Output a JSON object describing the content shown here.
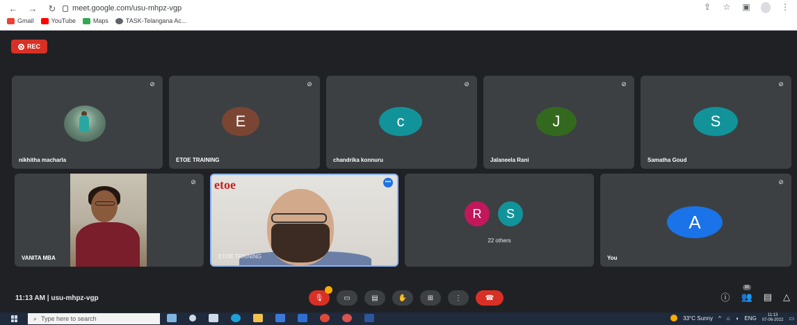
{
  "browser": {
    "url": "meet.google.com/usu-mhpz-vgp",
    "bookmarks": [
      "Gmail",
      "YouTube",
      "Maps",
      "TASK-Telangana Ac..."
    ]
  },
  "meet": {
    "rec_label": "REC",
    "participants_row1": [
      {
        "name": "nikhitha macharla",
        "initial": "",
        "color": ""
      },
      {
        "name": "ETOE TRAINING",
        "initial": "E",
        "color": "#7b4533"
      },
      {
        "name": "chandrika konnuru",
        "initial": "c",
        "color": "#12939a"
      },
      {
        "name": "Jalaneela Rani",
        "initial": "J",
        "color": "#33691e"
      },
      {
        "name": "Samatha Goud",
        "initial": "S",
        "color": "#12939a"
      }
    ],
    "participants_row2": {
      "vanita": "VANITA MBA",
      "etoe_logo": "etoe",
      "etoe_name": "ETOE TRAINING",
      "others_initials": [
        {
          "initial": "R",
          "color": "#c2185b"
        },
        {
          "initial": "S",
          "color": "#12939a"
        }
      ],
      "others_label": "22 others",
      "you_initial": "A",
      "you_color": "#1a73e8",
      "you_label": "You"
    },
    "bottom": {
      "time": "11:13 AM",
      "meeting_code": "usu-mhpz-vgp",
      "people_count": "30"
    }
  },
  "taskbar": {
    "search_placeholder": "Type here to search",
    "weather": "33°C  Sunny",
    "lang": "ENG",
    "time": "11:13",
    "date": "07-06-2022"
  },
  "colors": {
    "meet_bg": "#202124",
    "tile_bg": "#3c4043",
    "danger": "#d93025",
    "accent": "#1a73e8"
  }
}
